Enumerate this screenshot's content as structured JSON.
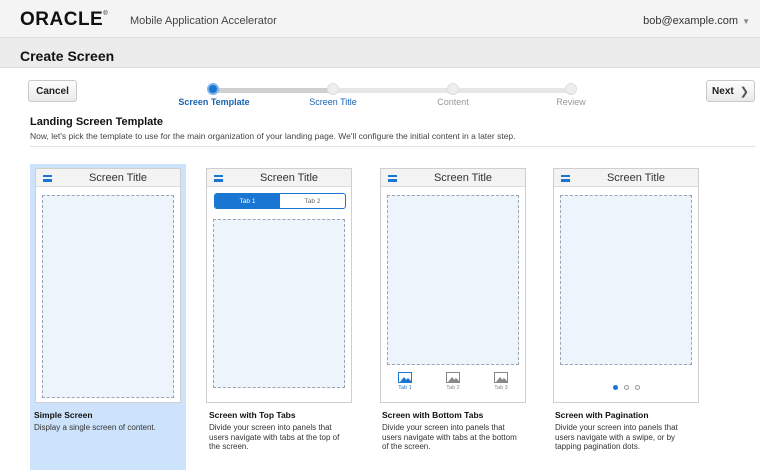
{
  "header": {
    "logo_text": "ORACLE",
    "logo_mark": "®",
    "app_name": "Mobile Application Accelerator",
    "user": "bob@example.com"
  },
  "page": {
    "title": "Create Screen"
  },
  "wizard": {
    "cancel_label": "Cancel",
    "next_label": "Next",
    "steps": [
      {
        "label": "Screen Template",
        "state": "current"
      },
      {
        "label": "Screen Title",
        "state": "next"
      },
      {
        "label": "Content",
        "state": "disabled"
      },
      {
        "label": "Review",
        "state": "disabled"
      }
    ]
  },
  "section": {
    "title": "Landing Screen Template",
    "description": "Now, let's pick the template to use for the main organization of your landing page. We'll configure the initial content in a later step."
  },
  "templates": [
    {
      "name": "Simple Screen",
      "description": "Display a single screen of content.",
      "preview_title": "Screen Title",
      "selected": true
    },
    {
      "name": "Screen with Top Tabs",
      "description": "Divide your screen into panels that users navigate with tabs at the top of the screen.",
      "preview_title": "Screen Title",
      "tabs": [
        "Tab 1",
        "Tab 2"
      ]
    },
    {
      "name": "Screen with Bottom Tabs",
      "description": "Divide your screen into panels that users navigate with tabs at the bottom of the screen.",
      "preview_title": "Screen Title",
      "tabs": [
        "Tab 1",
        "Tab 2",
        "Tab 3"
      ]
    },
    {
      "name": "Screen with Pagination",
      "description": "Divide your screen into panels that users navigate with a swipe, or by tapping pagination dots.",
      "preview_title": "Screen Title",
      "pages": 3,
      "current_page": 1
    }
  ],
  "colors": {
    "accent": "#1976d2",
    "selection": "#cde3fb",
    "link": "#1a64b3"
  },
  "icons": [
    "hamburger-menu-icon",
    "image-icon",
    "chevron-right-icon",
    "caret-down-icon"
  ]
}
